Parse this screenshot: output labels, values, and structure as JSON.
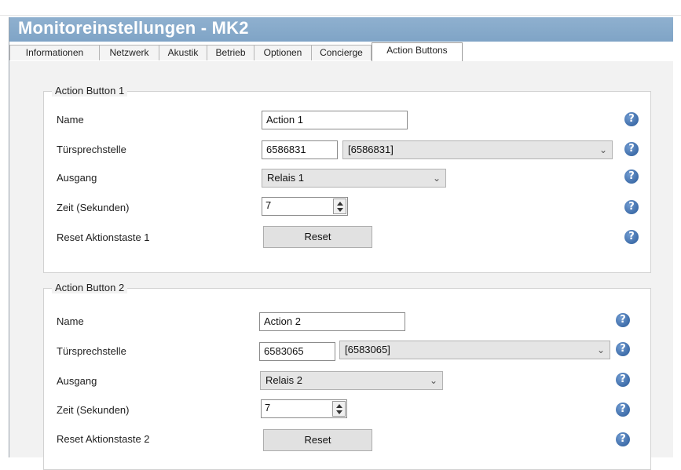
{
  "window": {
    "title": "Monitoreinstellungen - MK2"
  },
  "tabs": [
    {
      "label": "Informationen"
    },
    {
      "label": "Netzwerk"
    },
    {
      "label": "Akustik"
    },
    {
      "label": "Betrieb"
    },
    {
      "label": "Optionen"
    },
    {
      "label": "Concierge"
    },
    {
      "label": "Action Buttons",
      "active": true
    }
  ],
  "groups": [
    {
      "title": "Action Button 1",
      "name_label": "Name",
      "name_value": "Action 1",
      "door_label": "Türsprechstelle",
      "door_id": "6586831",
      "door_select": "[6586831]",
      "output_label": "Ausgang",
      "output_value": "Relais 1",
      "time_label": "Zeit (Sekunden)",
      "time_value": "7",
      "reset_label": "Reset Aktionstaste 1",
      "reset_button": "Reset"
    },
    {
      "title": "Action Button 2",
      "name_label": "Name",
      "name_value": "Action 2",
      "door_label": "Türsprechstelle",
      "door_id": "6583065",
      "door_select": "[6583065]",
      "output_label": "Ausgang",
      "output_value": "Relais 2",
      "time_label": "Zeit (Sekunden)",
      "time_value": "7",
      "reset_label": "Reset Aktionstaste 2",
      "reset_button": "Reset"
    }
  ],
  "icons": {
    "help": "help-icon",
    "dropdown": "chevron-down-icon",
    "spinner": "spinner-arrows-icon"
  },
  "colors": {
    "titlebar": "#7fa4c6",
    "help_icon": "#2a5a99"
  }
}
